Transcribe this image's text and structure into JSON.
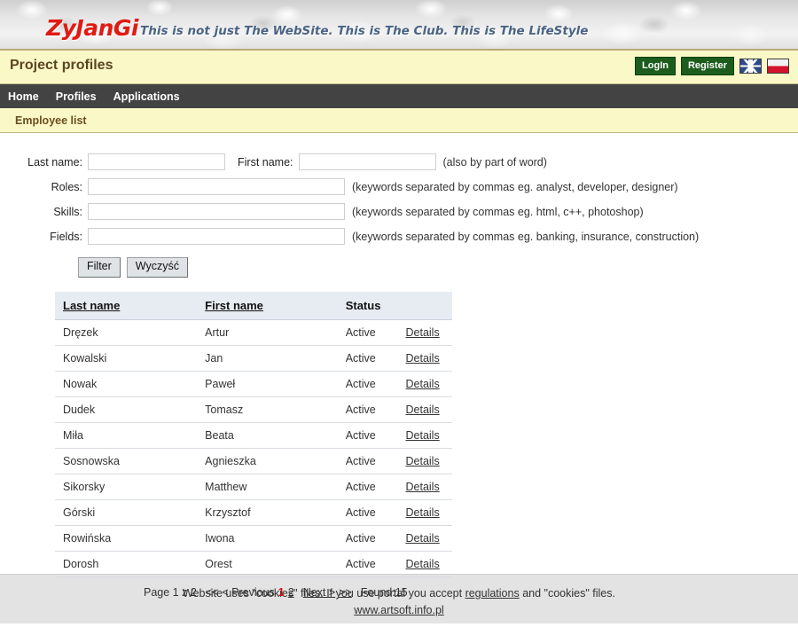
{
  "banner": {
    "logo": "ZyJanGi",
    "tagline": "This is not just The WebSite. This is The Club. This is The LifeStyle"
  },
  "titlebar": {
    "title": "Project profiles",
    "login_label": "LogIn",
    "register_label": "Register",
    "flag_en": "flag-uk-icon",
    "flag_pl": "flag-poland-icon"
  },
  "nav": {
    "items": [
      {
        "label": "Home"
      },
      {
        "label": "Profiles"
      },
      {
        "label": "Applications"
      }
    ]
  },
  "breadcrumb": {
    "text": "Employee list"
  },
  "filter_form": {
    "last_name_label": "Last name:",
    "last_name_value": "",
    "first_name_label": "First name:",
    "first_name_value": "",
    "name_hint": "(also by part of word)",
    "roles_label": "Roles:",
    "roles_value": "",
    "roles_hint": "(keywords separated by commas eg. analyst, developer, designer)",
    "skills_label": "Skills:",
    "skills_value": "",
    "skills_hint": "(keywords separated by commas eg. html, c++, photoshop)",
    "fields_label": "Fields:",
    "fields_value": "",
    "fields_hint": "(keywords separated by commas eg. banking, insurance, construction)",
    "filter_button": "Filter",
    "clear_button": "Wyczyść"
  },
  "table": {
    "columns": [
      "Last name",
      "First name",
      "Status",
      ""
    ],
    "details_label": "Details",
    "rows": [
      {
        "last": "Dręzek",
        "first": "Artur",
        "status": "Active"
      },
      {
        "last": "Kowalski",
        "first": "Jan",
        "status": "Active"
      },
      {
        "last": "Nowak",
        "first": "Paweł",
        "status": "Active"
      },
      {
        "last": "Dudek",
        "first": "Tomasz",
        "status": "Active"
      },
      {
        "last": "Miła",
        "first": "Beata",
        "status": "Active"
      },
      {
        "last": "Sosnowska",
        "first": "Agnieszka",
        "status": "Active"
      },
      {
        "last": "Sikorsky",
        "first": "Matthew",
        "status": "Active"
      },
      {
        "last": "Górski",
        "first": "Krzysztof",
        "status": "Active"
      },
      {
        "last": "Rowińska",
        "first": "Iwona",
        "status": "Active"
      },
      {
        "last": "Dorosh",
        "first": "Orest",
        "status": "Active"
      }
    ]
  },
  "pagination": {
    "page_label": "Page 1 z 2",
    "first": "<<",
    "prev": "< Previous",
    "page_current": "1",
    "page_other": "2",
    "next": "Next >",
    "last": ">>",
    "found": "Found:15"
  },
  "footer": {
    "line1_a": "Website uses \"cookies\" files. If you use portal you accept",
    "regulations_link": "regulations",
    "line1_b": "and \"cookies\" files.",
    "site_link": "www.artsoft.info.pl"
  }
}
